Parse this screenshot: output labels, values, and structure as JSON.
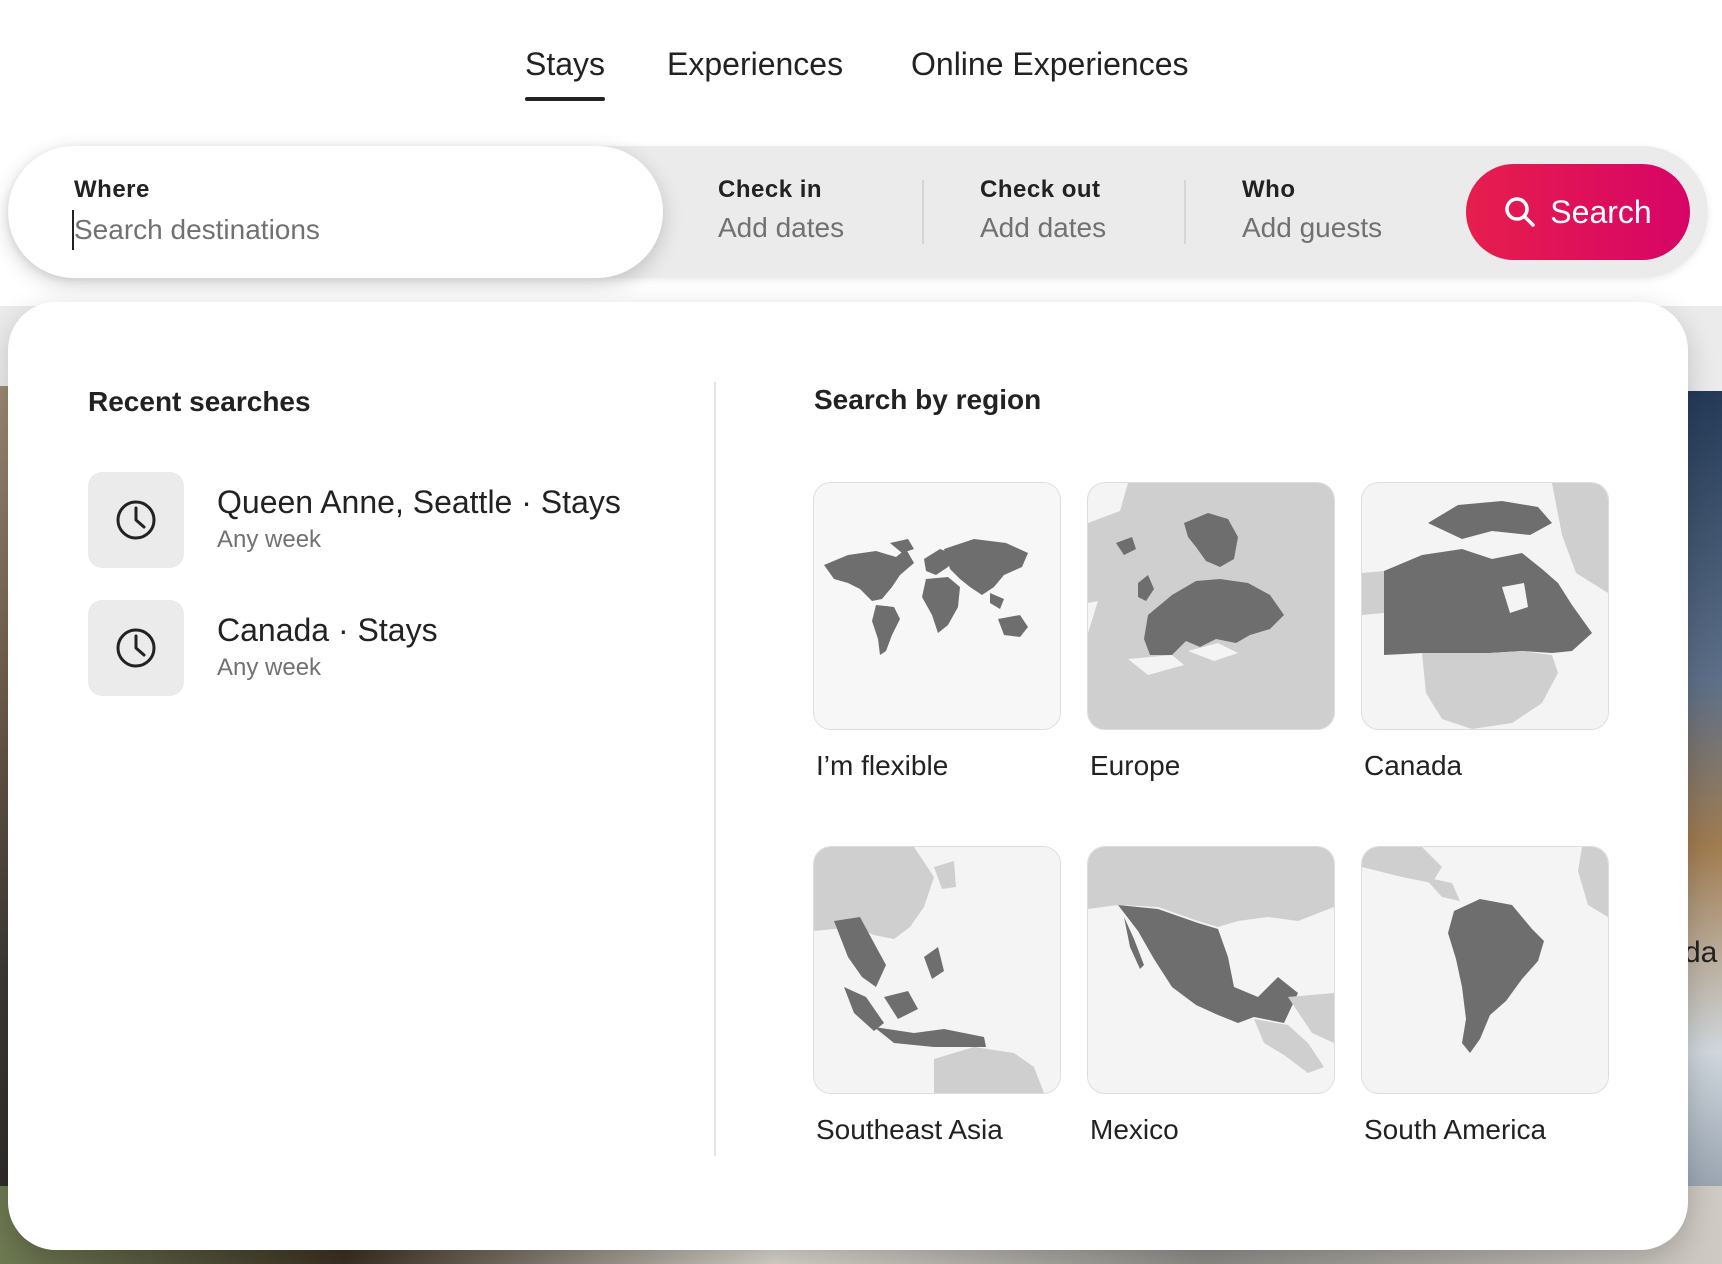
{
  "tabs": [
    {
      "label": "Stays",
      "active": true
    },
    {
      "label": "Experiences",
      "active": false
    },
    {
      "label": "Online Experiences",
      "active": false
    }
  ],
  "search": {
    "where_label": "Where",
    "where_placeholder": "Search destinations",
    "checkin_label": "Check in",
    "checkin_value": "Add dates",
    "checkout_label": "Check out",
    "checkout_value": "Add dates",
    "who_label": "Who",
    "who_value": "Add guests",
    "button_label": "Search",
    "accent_color": "#e61e4d"
  },
  "recent": {
    "title": "Recent searches",
    "items": [
      {
        "label": "Queen Anne, Seattle · Stays",
        "sub": "Any week",
        "icon": "clock-icon"
      },
      {
        "label": "Canada · Stays",
        "sub": "Any week",
        "icon": "clock-icon"
      }
    ]
  },
  "regions": {
    "title": "Search by region",
    "items": [
      {
        "label": "I’m flexible",
        "icon": "world-map-icon"
      },
      {
        "label": "Europe",
        "icon": "europe-map-icon"
      },
      {
        "label": "Canada",
        "icon": "canada-map-icon"
      },
      {
        "label": "Southeast Asia",
        "icon": "southeast-asia-map-icon"
      },
      {
        "label": "Mexico",
        "icon": "mexico-map-icon"
      },
      {
        "label": "South America",
        "icon": "south-america-map-icon"
      }
    ]
  },
  "background": {
    "partial_text": "da"
  }
}
